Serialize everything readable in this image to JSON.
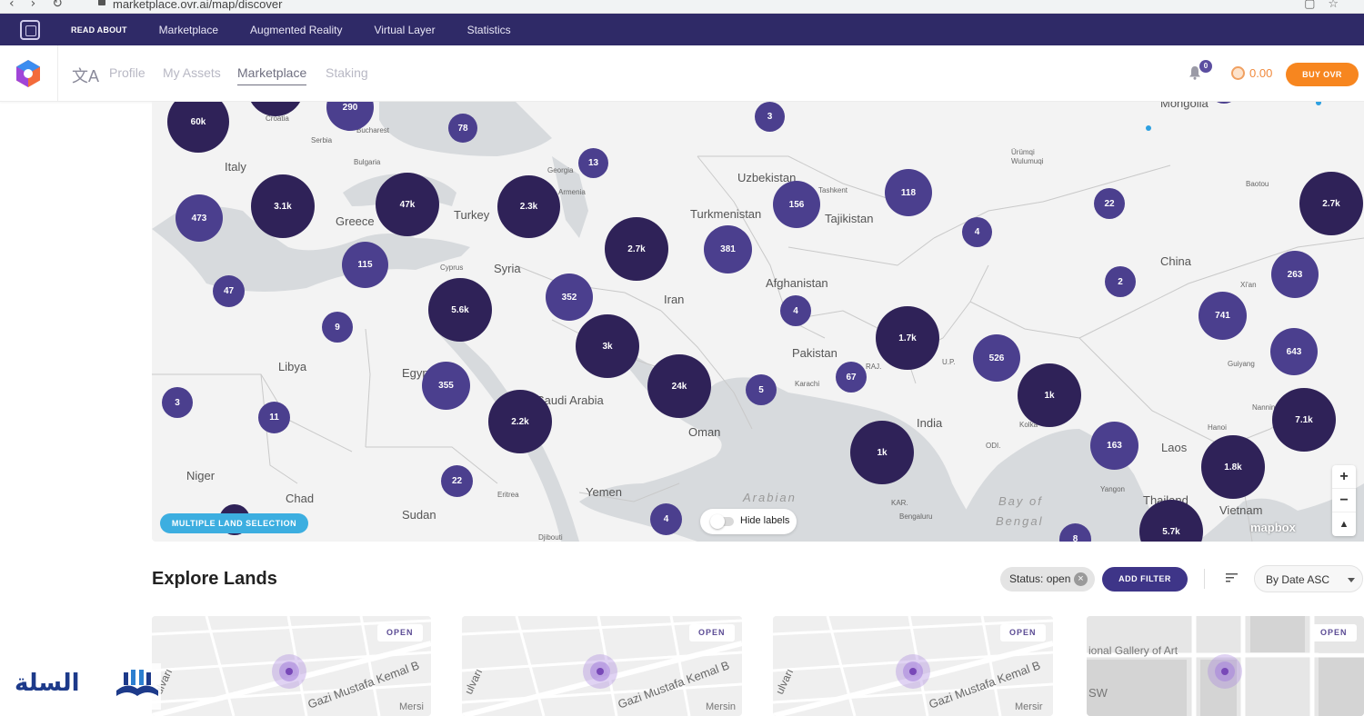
{
  "browser": {
    "url": "marketplace.ovr.ai/map/discover"
  },
  "topbar": {
    "read_about": "READ ABOUT",
    "links": [
      "Marketplace",
      "Augmented Reality",
      "Virtual Layer",
      "Statistics"
    ]
  },
  "subnav": {
    "tabs": [
      "Profile",
      "My Assets",
      "Marketplace",
      "Staking"
    ],
    "active_tab": "Marketplace",
    "notifications_count": "0",
    "balance": "0.00",
    "buy_label": "BUY OVR"
  },
  "map": {
    "countries": {
      "italy": "Italy",
      "greece": "Greece",
      "turkey": "Turkey",
      "syria": "Syria",
      "iran": "Iran",
      "turkmenistan": "Turkmenistan",
      "uzbekistan": "Uzbekistan",
      "tajikistan": "Tajikistan",
      "afghanistan": "Afghanistan",
      "pakistan": "Pakistan",
      "india": "India",
      "china": "China",
      "libya": "Libya",
      "egypt": "Egypt",
      "saudi": "Saudi Arabia",
      "oman": "Oman",
      "yemen": "Yemen",
      "sudan": "Sudan",
      "chad": "Chad",
      "niger": "Niger",
      "laos": "Laos",
      "thailand": "Thailand",
      "vietnam": "Vietnam",
      "mongolia": "Mongolia",
      "georgia": "Georgia",
      "armenia": "Armenia",
      "bulgaria": "Bulgaria",
      "serbia": "Serbia",
      "croatia": "Croatia",
      "bucharest": "Bucharest",
      "cyprus": "Cyprus",
      "eritrea": "Eritrea",
      "djibouti": "Djibouti",
      "tashkent": "Tashkent",
      "urumqi": "Ürümqi\nWulumuqi",
      "baotou": "Baotou",
      "xian": "Xi'an",
      "guiyang": "Guiyang",
      "nanning": "Nanning",
      "hanoi": "Hanoi",
      "yangon": "Yangon",
      "kolkata": "Kolka",
      "karachi": "Karachi",
      "bengaluru": "Bengaluru",
      "raj": "RAJ.",
      "up": "U.P.",
      "odi": "ODI.",
      "kar": "KAR."
    },
    "seas": {
      "arabian": "Arabian",
      "bay1": "Bay of",
      "bay2": "Bengal"
    },
    "clusters": [
      "60k",
      "290",
      "78",
      "3",
      "13",
      "3.1k",
      "47k",
      "2.3k",
      "473",
      "115",
      "47",
      "9",
      "5.6k",
      "352",
      "2.7k",
      "381",
      "156",
      "118",
      "22",
      "4",
      "2.7k",
      "3k",
      "4",
      "1.7k",
      "526",
      "2",
      "263",
      "741",
      "643",
      "24k",
      "5",
      "67",
      "1k",
      "7.1k",
      "355",
      "2.2k",
      "3",
      "11",
      "1k",
      "163",
      "1.8k",
      "22",
      "4",
      "8",
      "5.7k"
    ],
    "multiple_land_selection": "MULTIPLE LAND SELECTION",
    "hide_labels": "Hide labels",
    "zoom_in": "+",
    "zoom_out": "−",
    "compass": "▲",
    "attribution": "mapbox"
  },
  "explore": {
    "title": "Explore Lands",
    "status_chip": "Status: open",
    "add_filter": "ADD FILTER",
    "sort": "By Date ASC",
    "cards": [
      {
        "badge": "OPEN",
        "street": "Gazi Mustafa Kemal B",
        "street_side": "ulvarı",
        "bottom": "Mersi"
      },
      {
        "badge": "OPEN",
        "street": "Gazi Mustafa Kemal B",
        "street_side": "ulvarı",
        "bottom": "Mersin"
      },
      {
        "badge": "OPEN",
        "street": "Gazi Mustafa Kemal B",
        "street_side": "ulvarı",
        "bottom": "Mersir"
      },
      {
        "badge": "OPEN",
        "street": "ional Gallery of Art",
        "street_side": "",
        "bottom": "SW"
      }
    ]
  },
  "watermark": {
    "text": "السلة"
  }
}
